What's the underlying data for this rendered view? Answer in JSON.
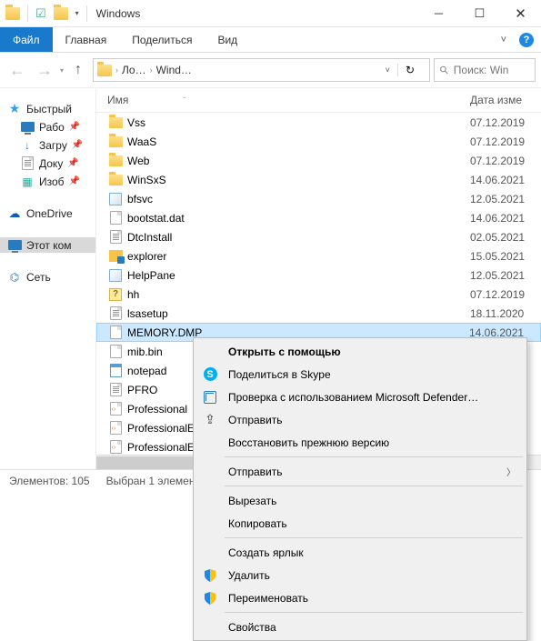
{
  "window": {
    "title": "Windows"
  },
  "ribbon": {
    "file": "Файл",
    "home": "Главная",
    "share": "Поделиться",
    "view": "Вид"
  },
  "nav": {
    "crumb1": "Ло…",
    "crumb2": "Wind…",
    "search_placeholder": "Поиск: Win"
  },
  "columns": {
    "name": "Имя",
    "date": "Дата изме"
  },
  "tree": {
    "quick": "Быстрый",
    "desktop": "Рабо",
    "downloads": "Загру",
    "documents": "Доку",
    "pictures": "Изоб",
    "onedrive": "OneDrive",
    "thispc": "Этот ком",
    "network": "Сеть"
  },
  "files": [
    {
      "name": "Vss",
      "date": "07.12.2019",
      "type": "folder"
    },
    {
      "name": "WaaS",
      "date": "07.12.2019",
      "type": "folder"
    },
    {
      "name": "Web",
      "date": "07.12.2019",
      "type": "folder"
    },
    {
      "name": "WinSxS",
      "date": "14.06.2021",
      "type": "folder"
    },
    {
      "name": "bfsvc",
      "date": "12.05.2021",
      "type": "exe"
    },
    {
      "name": "bootstat.dat",
      "date": "14.06.2021",
      "type": "file"
    },
    {
      "name": "DtcInstall",
      "date": "02.05.2021",
      "type": "txt"
    },
    {
      "name": "explorer",
      "date": "15.05.2021",
      "type": "explorer"
    },
    {
      "name": "HelpPane",
      "date": "12.05.2021",
      "type": "exe"
    },
    {
      "name": "hh",
      "date": "07.12.2019",
      "type": "hh"
    },
    {
      "name": "lsasetup",
      "date": "18.11.2020",
      "type": "txt"
    },
    {
      "name": "MEMORY.DMP",
      "date": "14.06.2021",
      "type": "file",
      "selected": true
    },
    {
      "name": "mib.bin",
      "date": "",
      "type": "file"
    },
    {
      "name": "notepad",
      "date": "",
      "type": "notepad"
    },
    {
      "name": "PFRO",
      "date": "",
      "type": "txt"
    },
    {
      "name": "Professional",
      "date": "",
      "type": "xml"
    },
    {
      "name": "ProfessionalE…",
      "date": "",
      "type": "xml"
    },
    {
      "name": "ProfessionalE…",
      "date": "",
      "type": "xml"
    }
  ],
  "status": {
    "count": "Элементов: 105",
    "selected": "Выбран 1 элемен"
  },
  "context": [
    {
      "label": "Открыть с помощью",
      "icon": "",
      "bold": true
    },
    {
      "label": "Поделиться в Skype",
      "icon": "skype"
    },
    {
      "label": "Проверка с использованием Microsoft Defender…",
      "icon": "defender"
    },
    {
      "label": "Отправить",
      "icon": "share"
    },
    {
      "label": "Восстановить прежнюю версию",
      "icon": ""
    },
    {
      "sep": true
    },
    {
      "label": "Отправить",
      "icon": "",
      "submenu": true
    },
    {
      "sep": true
    },
    {
      "label": "Вырезать",
      "icon": ""
    },
    {
      "label": "Копировать",
      "icon": ""
    },
    {
      "sep": true
    },
    {
      "label": "Создать ярлык",
      "icon": ""
    },
    {
      "label": "Удалить",
      "icon": "shield"
    },
    {
      "label": "Переименовать",
      "icon": "shield"
    },
    {
      "sep": true
    },
    {
      "label": "Свойства",
      "icon": ""
    }
  ]
}
